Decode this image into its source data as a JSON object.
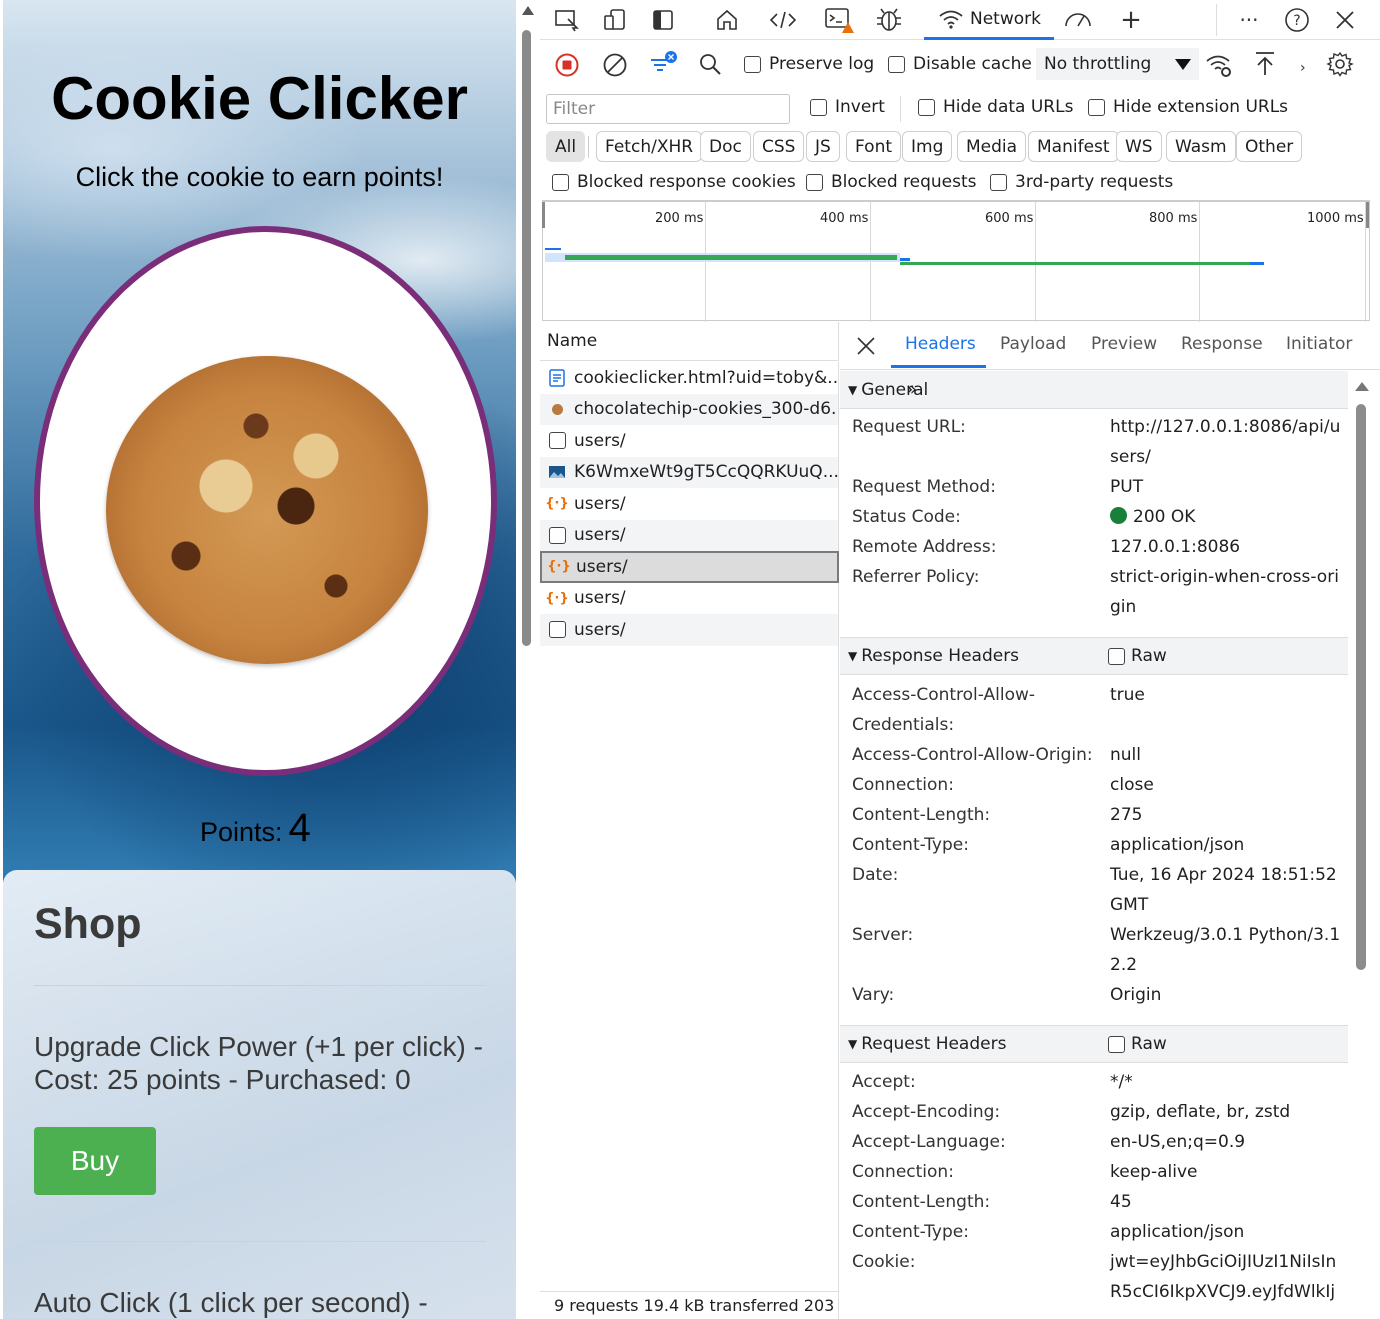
{
  "page": {
    "title": "Cookie Clicker",
    "subtitle": "Click the cookie to earn points!",
    "points_label": "Points:",
    "points_value": "4",
    "shop": {
      "heading": "Shop",
      "item1_text": "Upgrade Click Power (+1 per click) - Cost: 25 points - Purchased: 0",
      "buy_label": "Buy",
      "item2_text": "Auto Click (1 click per second) -"
    }
  },
  "devtools": {
    "tabs": {
      "network": "Network"
    },
    "toolbar": {
      "preserve_log": "Preserve log",
      "disable_cache": "Disable cache",
      "throttling": "No throttling"
    },
    "filter": {
      "placeholder": "Filter",
      "invert": "Invert",
      "hide_data_urls": "Hide data URLs",
      "hide_extension_urls": "Hide extension URLs"
    },
    "type_filters": [
      "All",
      "Fetch/XHR",
      "Doc",
      "CSS",
      "JS",
      "Font",
      "Img",
      "Media",
      "Manifest",
      "WS",
      "Wasm",
      "Other"
    ],
    "more_filters": {
      "blocked_cookies": "Blocked response cookies",
      "blocked_requests": "Blocked requests",
      "third_party": "3rd-party requests"
    },
    "timeline_ticks": [
      "200 ms",
      "400 ms",
      "600 ms",
      "800 ms",
      "1000 ms"
    ],
    "list_header": "Name",
    "requests": [
      {
        "name": "cookieclicker.html?uid=toby&...",
        "icon": "doc"
      },
      {
        "name": "chocolatechip-cookies_300-d6...",
        "icon": "img"
      },
      {
        "name": "users/",
        "icon": "checkbox"
      },
      {
        "name": "K6WmxeWt9gT5CcQQRKUuQ...",
        "icon": "img"
      },
      {
        "name": "users/",
        "icon": "fetch"
      },
      {
        "name": "users/",
        "icon": "checkbox"
      },
      {
        "name": "users/",
        "icon": "fetch",
        "selected": true
      },
      {
        "name": "users/",
        "icon": "fetch"
      },
      {
        "name": "users/",
        "icon": "checkbox"
      }
    ],
    "status_bar": "9 requests  19.4 kB transferred  203",
    "detail_tabs": [
      "Headers",
      "Payload",
      "Preview",
      "Response",
      "Initiator"
    ],
    "general": {
      "title": "General",
      "request_url_label": "Request URL:",
      "request_url": "http://127.0.0.1:8086/api/users/",
      "request_method_label": "Request Method:",
      "request_method": "PUT",
      "status_code_label": "Status Code:",
      "status_code": "200 OK",
      "remote_address_label": "Remote Address:",
      "remote_address": "127.0.0.1:8086",
      "referrer_policy_label": "Referrer Policy:",
      "referrer_policy": "strict-origin-when-cross-origin"
    },
    "response_headers": {
      "title": "Response Headers",
      "raw": "Raw",
      "rows": [
        {
          "k": "Access-Control-Allow-Credentials:",
          "v": "true"
        },
        {
          "k": "Access-Control-Allow-Origin:",
          "v": "null"
        },
        {
          "k": "Connection:",
          "v": "close"
        },
        {
          "k": "Content-Length:",
          "v": "275"
        },
        {
          "k": "Content-Type:",
          "v": "application/json"
        },
        {
          "k": "Date:",
          "v": "Tue, 16 Apr 2024 18:51:52 GMT"
        },
        {
          "k": "Server:",
          "v": "Werkzeug/3.0.1 Python/3.12.2"
        },
        {
          "k": "Vary:",
          "v": "Origin"
        }
      ]
    },
    "request_headers": {
      "title": "Request Headers",
      "raw": "Raw",
      "rows": [
        {
          "k": "Accept:",
          "v": "*/*"
        },
        {
          "k": "Accept-Encoding:",
          "v": "gzip, deflate, br, zstd"
        },
        {
          "k": "Accept-Language:",
          "v": "en-US,en;q=0.9"
        },
        {
          "k": "Connection:",
          "v": "keep-alive"
        },
        {
          "k": "Content-Length:",
          "v": "45"
        },
        {
          "k": "Content-Type:",
          "v": "application/json"
        },
        {
          "k": "Cookie:",
          "v": "jwt=eyJhbGciOiJIUzI1NiIsInR5cCI6IkpXVCJ9.eyJfdWlkIj"
        }
      ]
    }
  }
}
